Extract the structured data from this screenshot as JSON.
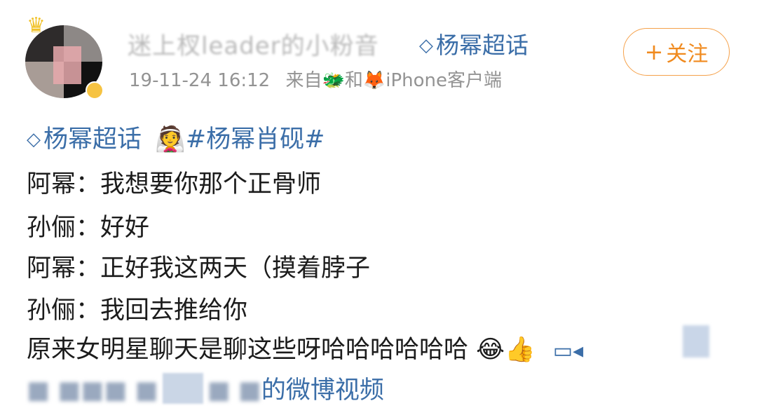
{
  "post": {
    "author_name": "迷上杈leader的小粉音",
    "author_supertopic": "杨幂超话",
    "timestamp": "19-11-24 16:12",
    "source_prefix": "来自",
    "source_emoji_1": "🐲",
    "source_join": "和",
    "source_emoji_2": "🦊",
    "source_device": "iPhone客户端",
    "follow_label": "关注",
    "follow_icon": "+"
  },
  "content": {
    "supertopic": "杨幂超话",
    "topic_emoji": "👰",
    "hashtag": "#杨幂肖砚#",
    "lines": [
      "阿幂：我想要你那个正骨师",
      "孙俪：好好",
      "阿幂：正好我这两天（摸着脖子",
      "孙俪：我回去推给你"
    ],
    "last_line": "原来女明星聊天是聊这些呀哈哈哈哈哈哈",
    "last_emojis": "😂👍",
    "video_link": "的微博视频",
    "icons": {
      "supertopic": "diamond-icon",
      "video": "video-camera-icon"
    }
  }
}
